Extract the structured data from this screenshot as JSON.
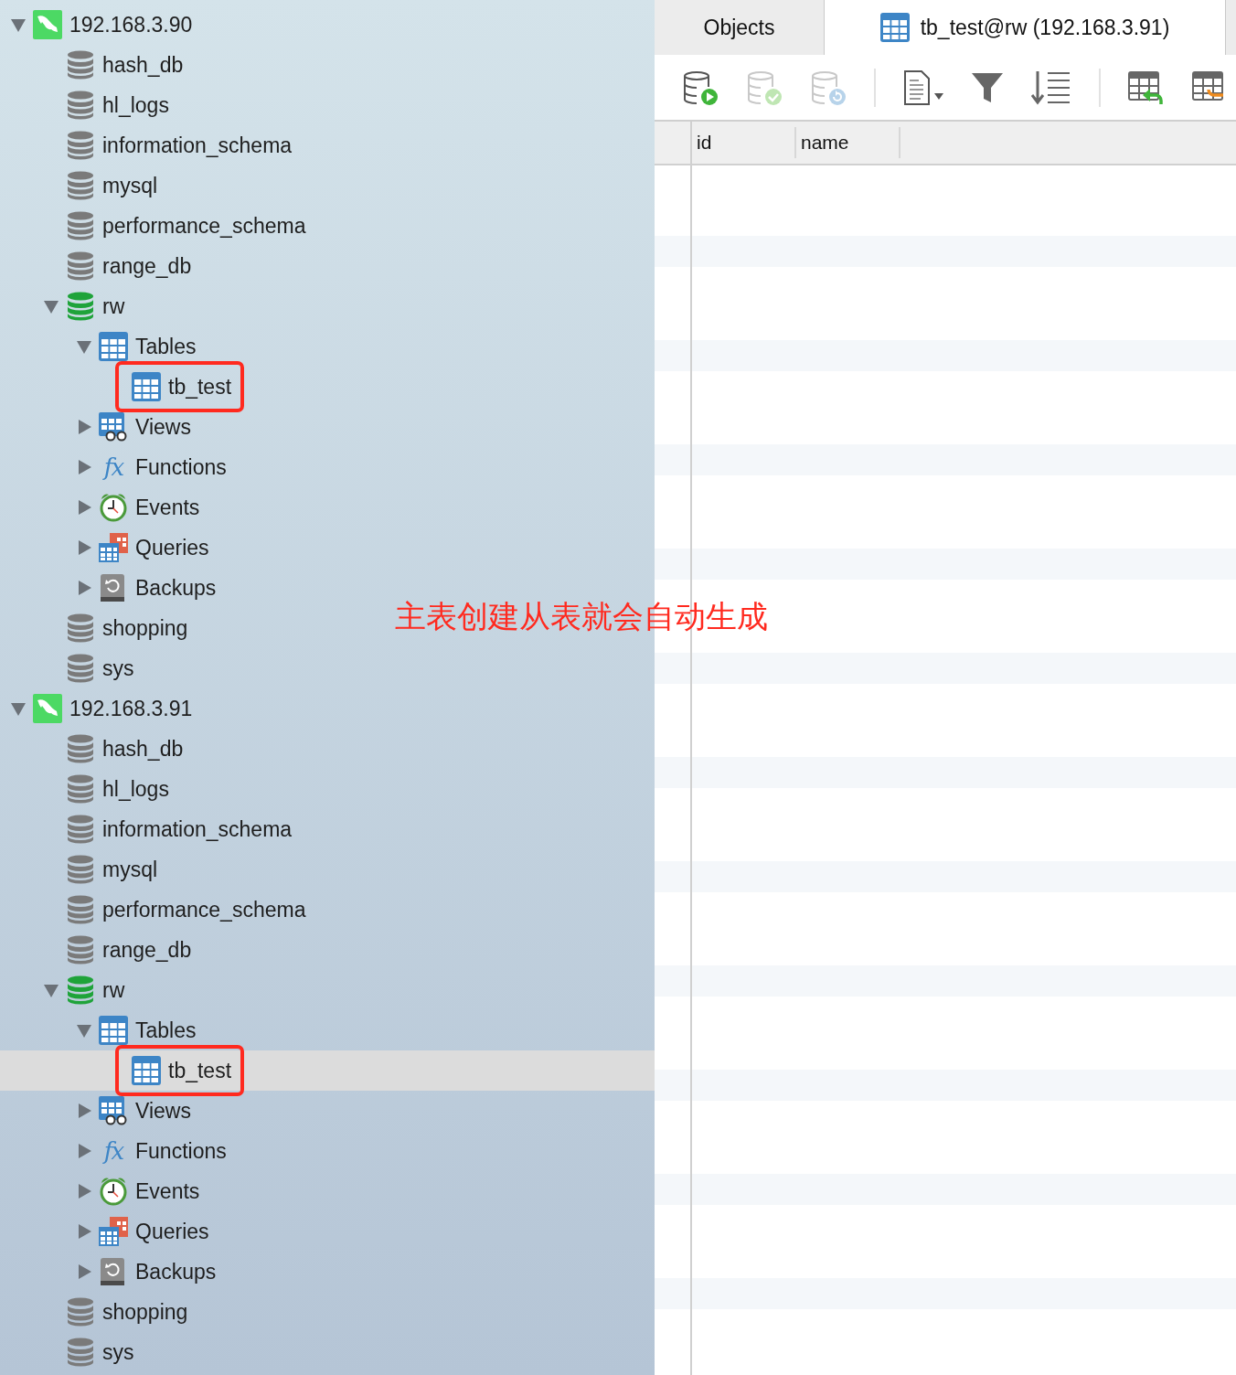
{
  "navigator": {
    "connections": [
      {
        "name": "192.168.3.90",
        "expanded": true,
        "databases": [
          {
            "name": "hash_db",
            "open": false
          },
          {
            "name": "hl_logs",
            "open": false
          },
          {
            "name": "information_schema",
            "open": false
          },
          {
            "name": "mysql",
            "open": false
          },
          {
            "name": "performance_schema",
            "open": false
          },
          {
            "name": "range_db",
            "open": false
          },
          {
            "name": "rw",
            "open": true,
            "groups": [
              {
                "kind": "tables",
                "name": "Tables",
                "expanded": true,
                "tables": [
                  {
                    "name": "tb_test",
                    "selected": false,
                    "marked": true
                  }
                ]
              },
              {
                "kind": "views",
                "name": "Views",
                "expanded": false
              },
              {
                "kind": "functions",
                "name": "Functions",
                "icon_text": "fx",
                "expanded": false
              },
              {
                "kind": "events",
                "name": "Events",
                "expanded": false
              },
              {
                "kind": "queries",
                "name": "Queries",
                "expanded": false
              },
              {
                "kind": "backups",
                "name": "Backups",
                "expanded": false
              }
            ]
          },
          {
            "name": "shopping",
            "open": false
          },
          {
            "name": "sys",
            "open": false
          }
        ]
      },
      {
        "name": "192.168.3.91",
        "expanded": true,
        "databases": [
          {
            "name": "hash_db",
            "open": false
          },
          {
            "name": "hl_logs",
            "open": false
          },
          {
            "name": "information_schema",
            "open": false
          },
          {
            "name": "mysql",
            "open": false
          },
          {
            "name": "performance_schema",
            "open": false
          },
          {
            "name": "range_db",
            "open": false
          },
          {
            "name": "rw",
            "open": true,
            "groups": [
              {
                "kind": "tables",
                "name": "Tables",
                "expanded": true,
                "tables": [
                  {
                    "name": "tb_test",
                    "selected": true,
                    "marked": true
                  }
                ]
              },
              {
                "kind": "views",
                "name": "Views",
                "expanded": false
              },
              {
                "kind": "functions",
                "name": "Functions",
                "icon_text": "fx",
                "expanded": false
              },
              {
                "kind": "events",
                "name": "Events",
                "expanded": false
              },
              {
                "kind": "queries",
                "name": "Queries",
                "expanded": false
              },
              {
                "kind": "backups",
                "name": "Backups",
                "expanded": false
              }
            ]
          },
          {
            "name": "shopping",
            "open": false
          },
          {
            "name": "sys",
            "open": false
          }
        ]
      }
    ]
  },
  "tabs": [
    {
      "label": "Objects",
      "kind": "objects",
      "selected": false
    },
    {
      "label": "tb_test@rw (192.168.3.91)",
      "kind": "table",
      "selected": true
    }
  ],
  "toolbar": [
    [
      {
        "kind": "run",
        "disabled": false
      },
      {
        "kind": "commit",
        "disabled": true
      },
      {
        "kind": "rollback",
        "disabled": true
      }
    ],
    [
      {
        "kind": "document",
        "disabled": false
      },
      {
        "kind": "filter",
        "disabled": false
      },
      {
        "kind": "sort",
        "disabled": false
      }
    ],
    [
      {
        "kind": "import",
        "disabled": false
      },
      {
        "kind": "export",
        "disabled": false
      }
    ]
  ],
  "grid": {
    "columns": [
      "id",
      "name"
    ]
  },
  "annotation": {
    "text": "主表创建从表就会自动生成"
  }
}
